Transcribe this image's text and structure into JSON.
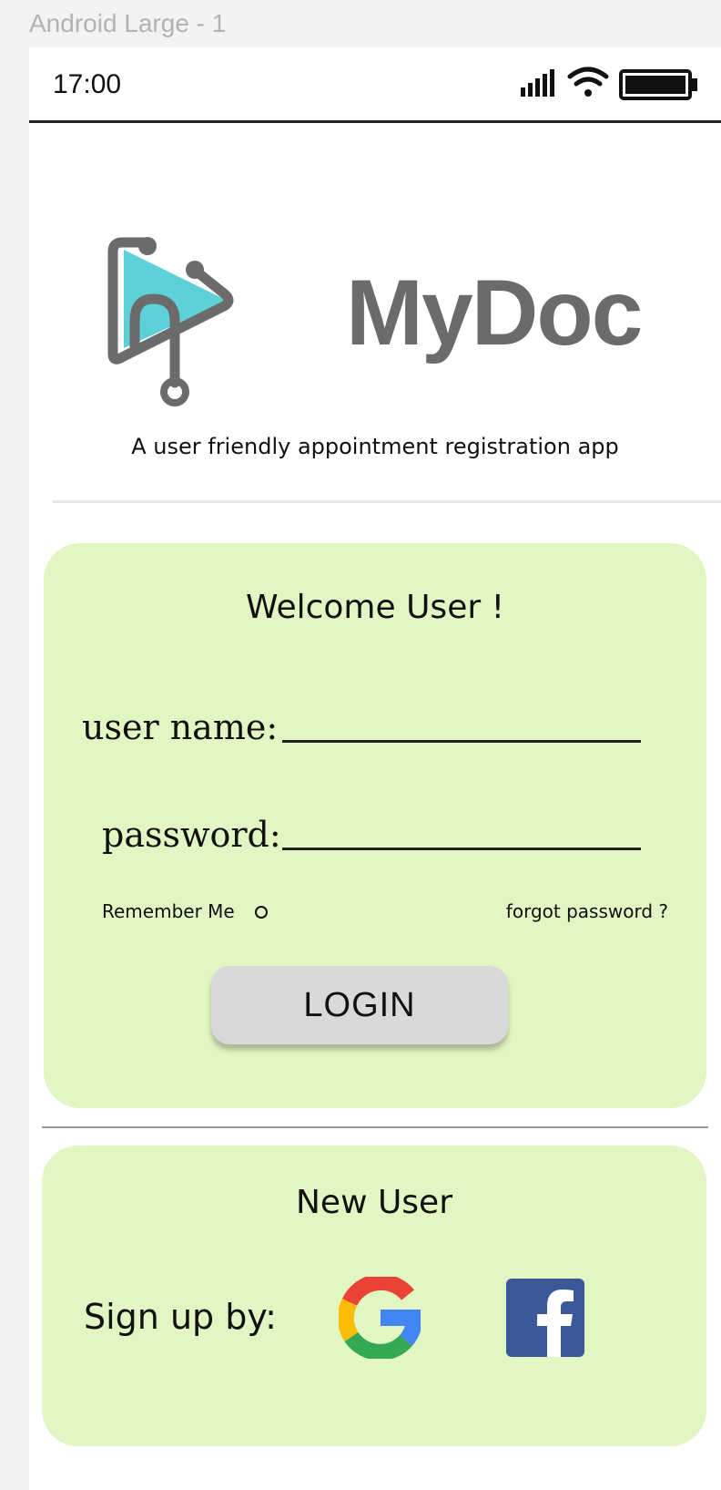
{
  "frame": {
    "label": "Android Large - 1"
  },
  "status_bar": {
    "time": "17:00"
  },
  "brand": {
    "name": "MyDoc",
    "tagline": "A user friendly appointment registration app",
    "colors": {
      "accent": "#5ed0d8",
      "logo_gray": "#6b6b6b"
    }
  },
  "login": {
    "title": "Welcome User !",
    "username_label": "user name:",
    "password_label": "password:",
    "remember_me": "Remember Me",
    "forgot_password": "forgot password ?",
    "login_button": "LOGIN",
    "card_color": "#e2f6c4"
  },
  "signup": {
    "title": "New User",
    "label": "Sign up by:",
    "providers": [
      "google-icon",
      "facebook-icon"
    ]
  }
}
